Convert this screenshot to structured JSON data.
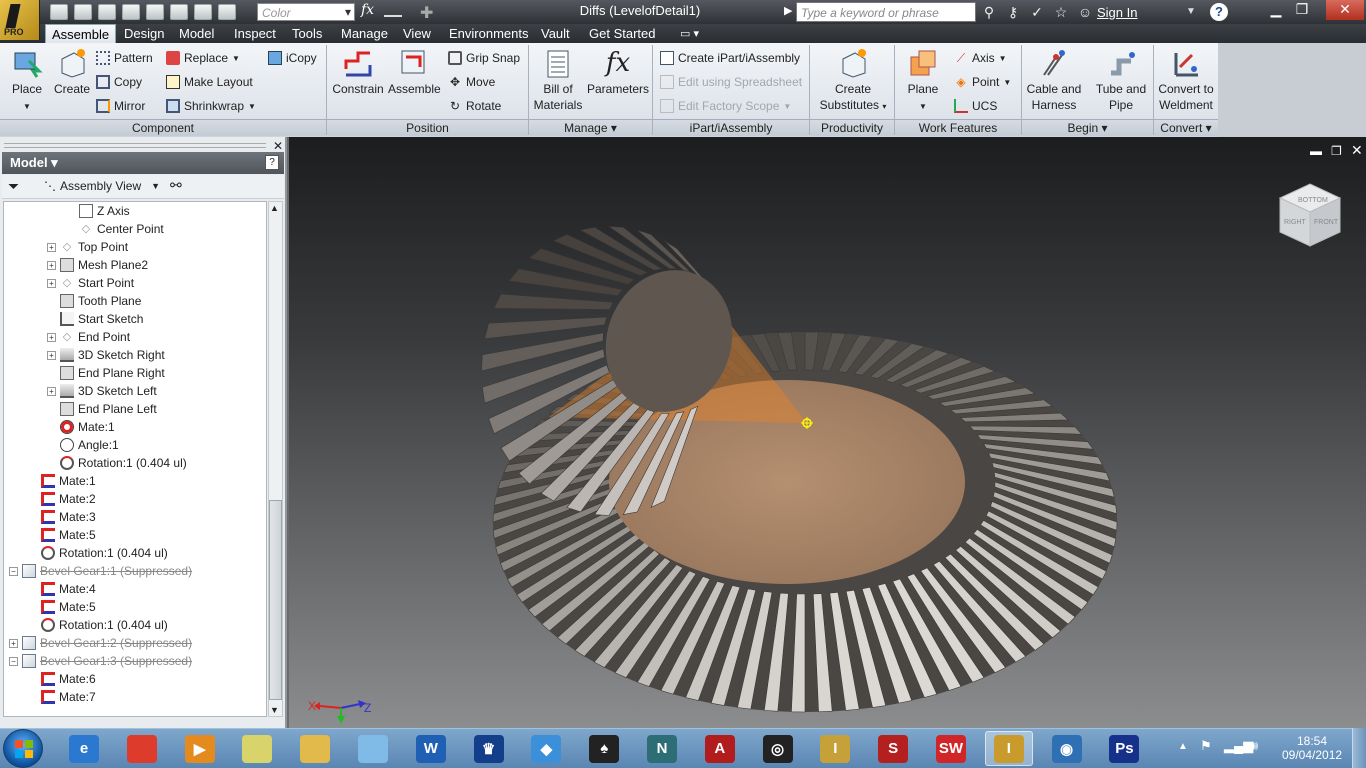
{
  "window": {
    "title": "Diffs (LevelofDetail1)",
    "color_placeholder": "Color",
    "search_placeholder": "Type a keyword or phrase",
    "sign_in": "Sign In",
    "help": "?",
    "app_badge": "PRO"
  },
  "tabs": [
    "Assemble",
    "Design",
    "Model",
    "Inspect",
    "Tools",
    "Manage",
    "View",
    "Environments",
    "Vault",
    "Get Started"
  ],
  "ribbon": {
    "component": {
      "label": "Component",
      "place": "Place",
      "create": "Create",
      "pattern": "Pattern",
      "copy": "Copy",
      "mirror": "Mirror",
      "replace": "Replace",
      "make_layout": "Make Layout",
      "shrinkwrap": "Shrinkwrap",
      "icopy": "iCopy"
    },
    "position": {
      "label": "Position",
      "constrain": "Constrain",
      "assemble": "Assemble",
      "grip_snap": "Grip Snap",
      "move": "Move",
      "rotate": "Rotate"
    },
    "manage": {
      "label": "Manage",
      "bom_line1": "Bill of",
      "bom_line2": "Materials",
      "parameters": "Parameters"
    },
    "ipart": {
      "label": "iPart/iAssembly",
      "create": "Create iPart/iAssembly",
      "edit_spreadsheet": "Edit using Spreadsheet",
      "edit_factory": "Edit Factory Scope"
    },
    "productivity": {
      "label": "Productivity",
      "line1": "Create",
      "line2": "Substitutes"
    },
    "work_features": {
      "label": "Work Features",
      "plane": "Plane",
      "axis": "Axis",
      "point": "Point",
      "ucs": "UCS"
    },
    "begin": {
      "label": "Begin",
      "cable_1": "Cable and",
      "cable_2": "Harness",
      "tube_1": "Tube and",
      "tube_2": "Pipe"
    },
    "convert": {
      "label": "Convert",
      "line1": "Convert to",
      "line2": "Weldment"
    }
  },
  "browser": {
    "title": "Model",
    "view": "Assembly View",
    "help": "?",
    "tree": [
      {
        "label": "Z Axis",
        "icon": "axis-icon",
        "indent": 4,
        "expander": false,
        "suppressed": false
      },
      {
        "label": "Center Point",
        "icon": "point-icon",
        "indent": 4,
        "expander": false,
        "suppressed": false
      },
      {
        "label": "Top Point",
        "icon": "point-icon",
        "indent": 3,
        "expander": true,
        "suppressed": false
      },
      {
        "label": "Mesh Plane2",
        "icon": "plane-icon",
        "indent": 3,
        "expander": true,
        "suppressed": false
      },
      {
        "label": "Start Point",
        "icon": "point-icon",
        "indent": 3,
        "expander": true,
        "suppressed": false
      },
      {
        "label": "Tooth Plane",
        "icon": "plane-icon",
        "indent": 3,
        "expander": false,
        "suppressed": false
      },
      {
        "label": "Start Sketch",
        "icon": "sketch-icon",
        "indent": 3,
        "expander": false,
        "suppressed": false
      },
      {
        "label": "End Point",
        "icon": "point-icon",
        "indent": 3,
        "expander": true,
        "suppressed": false
      },
      {
        "label": "3D Sketch Right",
        "icon": "sketch3d-icon",
        "indent": 3,
        "expander": true,
        "suppressed": false
      },
      {
        "label": "End Plane Right",
        "icon": "plane-icon",
        "indent": 3,
        "expander": false,
        "suppressed": false
      },
      {
        "label": "3D Sketch Left",
        "icon": "sketch3d-icon",
        "indent": 3,
        "expander": true,
        "suppressed": false
      },
      {
        "label": "End Plane Left",
        "icon": "plane-icon",
        "indent": 3,
        "expander": false,
        "suppressed": false
      },
      {
        "label": "Mate:1",
        "icon": "mate-circle-icon",
        "indent": 3,
        "expander": false,
        "suppressed": false
      },
      {
        "label": "Angle:1",
        "icon": "angle-icon",
        "indent": 3,
        "expander": false,
        "suppressed": false
      },
      {
        "label": "Rotation:1 (0.404 ul)",
        "icon": "rotation-icon",
        "indent": 3,
        "expander": false,
        "suppressed": false
      },
      {
        "label": "Mate:1",
        "icon": "mate-icon",
        "indent": 2,
        "expander": false,
        "suppressed": false
      },
      {
        "label": "Mate:2",
        "icon": "mate-icon",
        "indent": 2,
        "expander": false,
        "suppressed": false
      },
      {
        "label": "Mate:3",
        "icon": "mate-icon",
        "indent": 2,
        "expander": false,
        "suppressed": false
      },
      {
        "label": "Mate:5",
        "icon": "mate-icon",
        "indent": 2,
        "expander": false,
        "suppressed": false
      },
      {
        "label": "Rotation:1 (0.404 ul)",
        "icon": "rotation-icon",
        "indent": 2,
        "expander": false,
        "suppressed": false
      },
      {
        "label": "Bevel Gear1:1 (Suppressed)",
        "icon": "part-icon",
        "indent": 1,
        "expander": "minus",
        "suppressed": true
      },
      {
        "label": "Mate:4",
        "icon": "mate-icon",
        "indent": 2,
        "expander": false,
        "suppressed": false
      },
      {
        "label": "Mate:5",
        "icon": "mate-icon",
        "indent": 2,
        "expander": false,
        "suppressed": false
      },
      {
        "label": "Rotation:1 (0.404 ul)",
        "icon": "rotation-icon",
        "indent": 2,
        "expander": false,
        "suppressed": false
      },
      {
        "label": "Bevel Gear1:2 (Suppressed)",
        "icon": "part-icon",
        "indent": 1,
        "expander": true,
        "suppressed": true
      },
      {
        "label": "Bevel Gear1:3 (Suppressed)",
        "icon": "part-icon",
        "indent": 1,
        "expander": "minus",
        "suppressed": true
      },
      {
        "label": "Mate:6",
        "icon": "mate-icon",
        "indent": 2,
        "expander": false,
        "suppressed": false
      },
      {
        "label": "Mate:7",
        "icon": "mate-icon",
        "indent": 2,
        "expander": false,
        "suppressed": false
      }
    ]
  },
  "viewport": {
    "triad_x": "X",
    "triad_z": "Z",
    "viewcube_top": "BOTTOM",
    "viewcube_left": "RIGHT",
    "viewcube_right": "FRONT"
  },
  "taskbar": {
    "apps": [
      {
        "name": "internet-explorer",
        "glyph": "e",
        "color": "#2a78d0"
      },
      {
        "name": "chrome",
        "glyph": "",
        "color": "#dd3b2b"
      },
      {
        "name": "media-player",
        "glyph": "▶",
        "color": "#e58a1e"
      },
      {
        "name": "sticky-notes",
        "glyph": "",
        "color": "#d8d36a"
      },
      {
        "name": "file-explorer",
        "glyph": "",
        "color": "#e2b94b"
      },
      {
        "name": "notepad",
        "glyph": "",
        "color": "#7fbbe6"
      },
      {
        "name": "word",
        "glyph": "W",
        "color": "#1f5fb4"
      },
      {
        "name": "game-chess",
        "glyph": "♛",
        "color": "#133f8a"
      },
      {
        "name": "dropbox",
        "glyph": "◆",
        "color": "#3c8fd9"
      },
      {
        "name": "inkscape",
        "glyph": "♠",
        "color": "#222"
      },
      {
        "name": "3ds-max",
        "glyph": "N",
        "color": "#2d6e76"
      },
      {
        "name": "autocad",
        "glyph": "A",
        "color": "#b11c1c"
      },
      {
        "name": "maya",
        "glyph": "◎",
        "color": "#222"
      },
      {
        "name": "inventor-pro",
        "glyph": "I",
        "color": "#c6a13a"
      },
      {
        "name": "solidworks-360",
        "glyph": "S",
        "color": "#b41f1f"
      },
      {
        "name": "solidworks",
        "glyph": "SW",
        "color": "#d0262a"
      },
      {
        "name": "inventor",
        "glyph": "I",
        "color": "#c99b2d"
      },
      {
        "name": "keyshot",
        "glyph": "◉",
        "color": "#2f6fb4"
      },
      {
        "name": "photoshop",
        "glyph": "Ps",
        "color": "#16318a"
      }
    ],
    "active_index": 16,
    "time": "18:54",
    "date": "09/04/2012"
  }
}
